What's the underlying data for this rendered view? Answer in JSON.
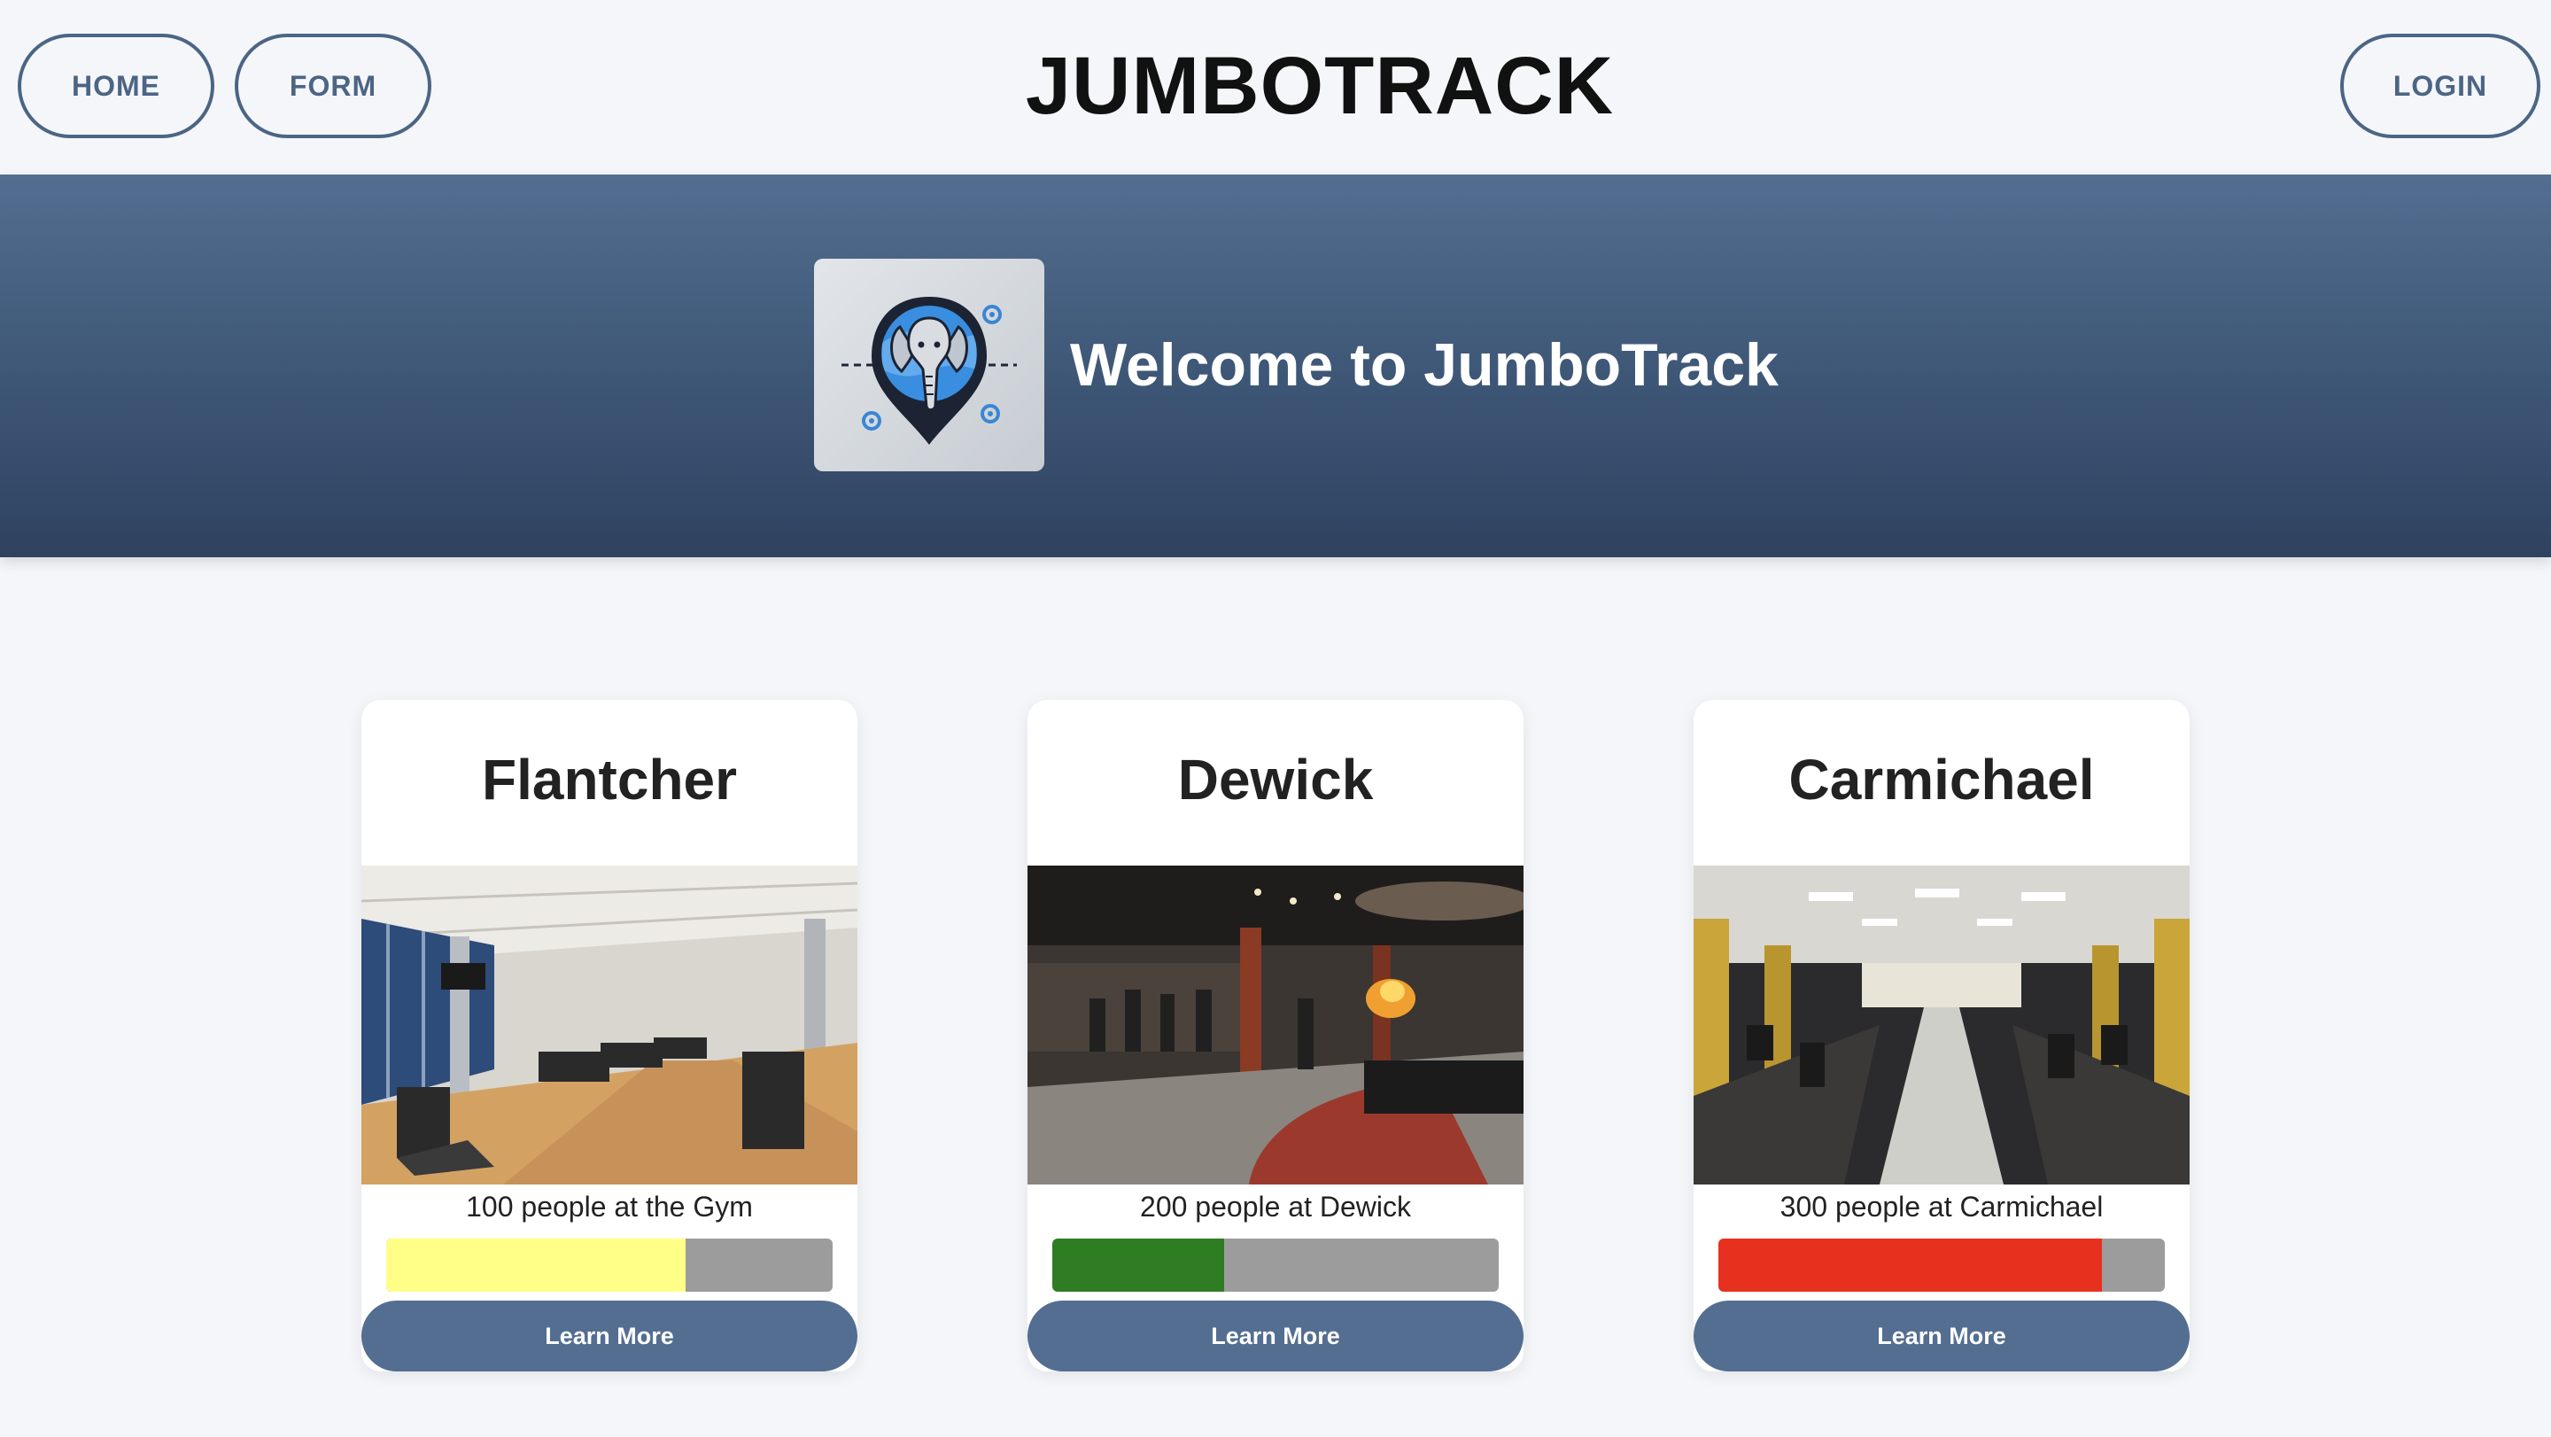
{
  "nav": {
    "home_label": "HOME",
    "form_label": "FORM",
    "login_label": "LOGIN",
    "brand": "JUMBOTRACK"
  },
  "hero": {
    "title": "Welcome to JumboTrack",
    "logo_icon": "elephant-location-pin-icon"
  },
  "colors": {
    "accent": "#4c6585",
    "button": "#546e92",
    "meter_track": "#9c9c9c"
  },
  "cards": [
    {
      "title": "Flantcher",
      "photo": "gym-interior-photo",
      "count_text": "100 people at the Gym",
      "occupancy_fraction": 0.67,
      "meter_color": "#ffff88",
      "button_label": "Learn More"
    },
    {
      "title": "Dewick",
      "photo": "dining-hall-photo",
      "count_text": "200 people at Dewick",
      "occupancy_fraction": 0.385,
      "meter_color": "#2e7d22",
      "button_label": "Learn More"
    },
    {
      "title": "Carmichael",
      "photo": "carmichael-dining-photo",
      "count_text": "300 people at Carmichael",
      "occupancy_fraction": 0.86,
      "meter_color": "#e8301f",
      "button_label": "Learn More"
    }
  ]
}
